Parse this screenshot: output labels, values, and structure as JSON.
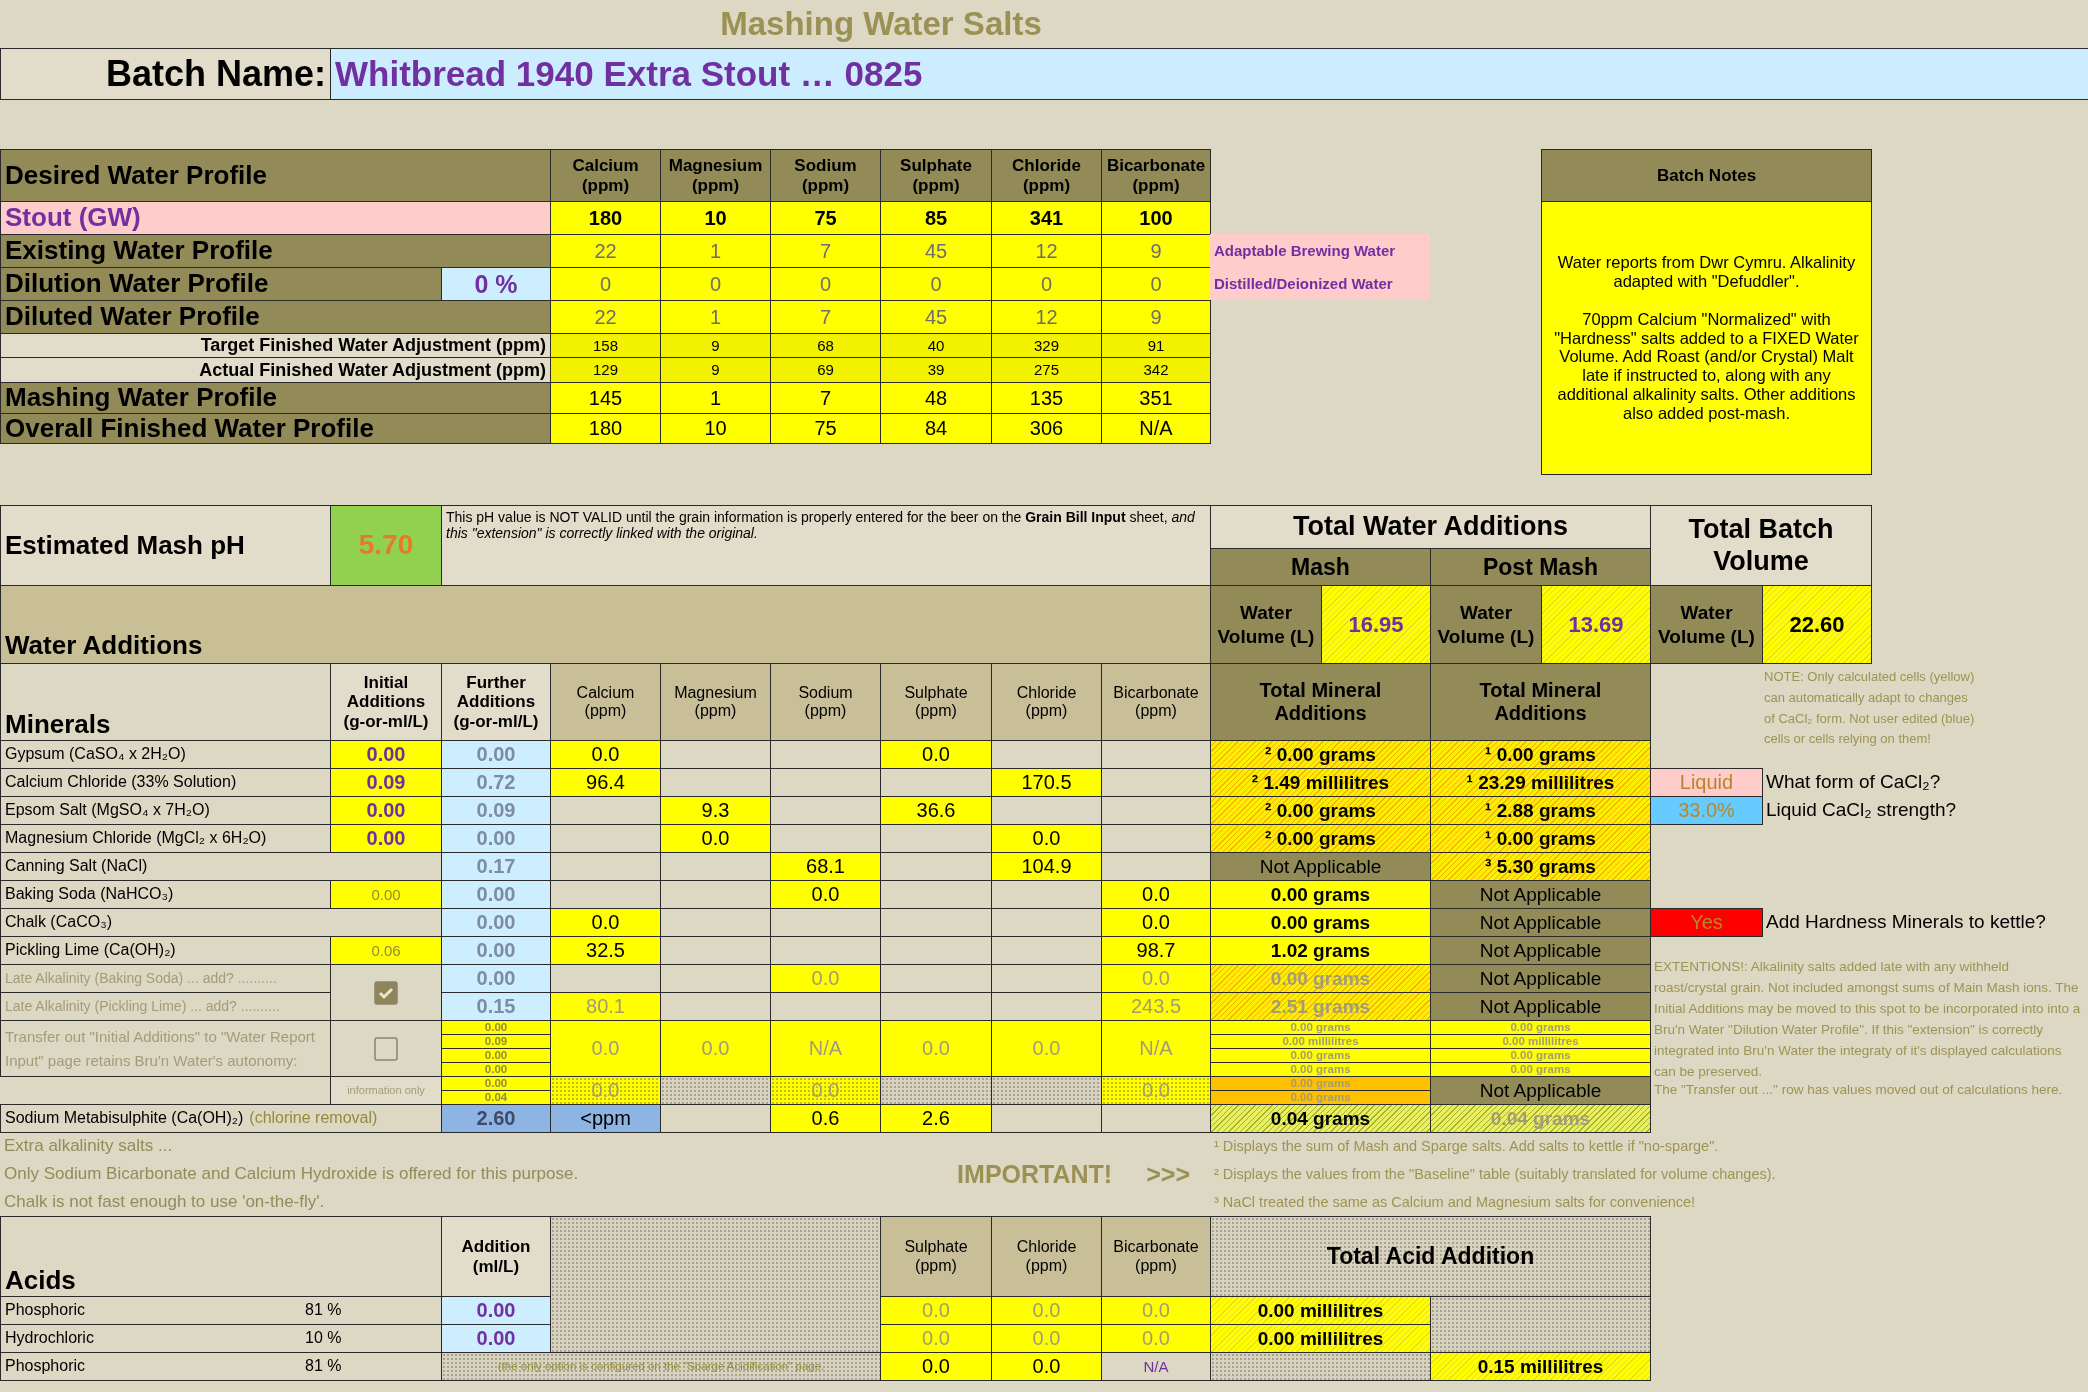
{
  "title": "Mashing Water Salts",
  "batch": {
    "label": "Batch Name:",
    "value": "Whitbread 1940 Extra Stout … 0825"
  },
  "profile": {
    "heading": "Desired Water Profile",
    "columns": [
      {
        "name": "Calcium",
        "unit": "(ppm)"
      },
      {
        "name": "Magnesium",
        "unit": "(ppm)"
      },
      {
        "name": "Sodium",
        "unit": "(ppm)"
      },
      {
        "name": "Sulphate",
        "unit": "(ppm)"
      },
      {
        "name": "Chloride",
        "unit": "(ppm)"
      },
      {
        "name": "Bicarbonate",
        "unit": "(ppm)"
      }
    ],
    "rows": [
      {
        "label": "Stout (GW)",
        "kind": "target",
        "values": [
          "180",
          "10",
          "75",
          "85",
          "341",
          "100"
        ]
      },
      {
        "label": "Existing Water Profile",
        "kind": "source",
        "values": [
          "22",
          "1",
          "7",
          "45",
          "12",
          "9"
        ],
        "source": "Adaptable Brewing Water"
      },
      {
        "label": "Dilution Water Profile",
        "kind": "source",
        "dilution": "0 %",
        "values": [
          "0",
          "0",
          "0",
          "0",
          "0",
          "0"
        ],
        "source": "Distilled/Deionized Water"
      },
      {
        "label": "Diluted Water Profile",
        "kind": "source",
        "values": [
          "22",
          "1",
          "7",
          "45",
          "12",
          "9"
        ]
      },
      {
        "label": "Target Finished Water Adjustment (ppm)",
        "kind": "adjustment",
        "values": [
          "158",
          "9",
          "68",
          "40",
          "329",
          "91"
        ]
      },
      {
        "label": "Actual Finished Water Adjustment (ppm)",
        "kind": "adjustment",
        "values": [
          "129",
          "9",
          "69",
          "39",
          "275",
          "342"
        ]
      },
      {
        "label": "Mashing Water Profile",
        "kind": "result",
        "values": [
          "145",
          "1",
          "7",
          "48",
          "135",
          "351"
        ]
      },
      {
        "label": "Overall Finished Water Profile",
        "kind": "result",
        "values": [
          "180",
          "10",
          "75",
          "84",
          "306",
          "N/A"
        ]
      }
    ]
  },
  "batch_notes": {
    "title": "Batch Notes",
    "paragraphs": [
      "Water reports from Dwr Cymru. Alkalinity adapted with \"Defuddler\".",
      "70ppm Calcium \"Normalized\" with \"Hardness\" salts added to a FIXED Water Volume. Add Roast (and/or Crystal) Malt late if instructed to, along with any additional alkalinity salts. Other additions also added post-mash."
    ]
  },
  "mash_ph": {
    "label": "Estimated Mash pH",
    "value": "5.70",
    "note": "This pH value is NOT VALID until the grain information is properly entered for the beer on the **Grain Bill Input** sheet, *and this \"extension\" is correctly linked with the original.*"
  },
  "water_additions": {
    "heading": "Water Additions",
    "totals_heading": "Total Water Additions",
    "mash": {
      "label": "Mash",
      "volume_label": "Water Volume (L)",
      "volume": "16.95"
    },
    "post_mash": {
      "label": "Post Mash",
      "volume_label": "Water Volume (L)",
      "volume": "13.69"
    },
    "batch_total": {
      "label": "Total Batch Volume",
      "volume_label": "Water Volume (L)",
      "volume": "22.60"
    }
  },
  "minerals": {
    "heading": "Minerals",
    "columns": [
      {
        "name": "Initial Additions",
        "unit": "(g-or-ml/L)",
        "kind": "input"
      },
      {
        "name": "Further Additions",
        "unit": "(g-or-ml/L)",
        "kind": "input"
      },
      {
        "name": "Calcium",
        "unit": "(ppm)",
        "kind": "ion"
      },
      {
        "name": "Magnesium",
        "unit": "(ppm)",
        "kind": "ion"
      },
      {
        "name": "Sodium",
        "unit": "(ppm)",
        "kind": "ion"
      },
      {
        "name": "Sulphate",
        "unit": "(ppm)",
        "kind": "ion"
      },
      {
        "name": "Chloride",
        "unit": "(ppm)",
        "kind": "ion"
      },
      {
        "name": "Bicarbonate",
        "unit": "(ppm)",
        "kind": "ion"
      }
    ],
    "totals_headings": [
      "Total Mineral Additions",
      "Total Mineral Additions"
    ],
    "rows": [
      {
        "kind": "mineral",
        "label": "Gypsum (CaSO₄ x 2H₂O)",
        "initial": {
          "text": "0.00",
          "kind": "entry"
        },
        "further": "0.00",
        "ions": {
          "calcium": "0.0",
          "sulphate": "0.0"
        },
        "mash_total": {
          "text": "² 0.00 grams",
          "kind": "value"
        },
        "post_total": {
          "text": "¹ 0.00 grams",
          "kind": "value"
        }
      },
      {
        "kind": "mineral",
        "label": "Calcium Chloride (33% Solution)",
        "initial": {
          "text": "0.09",
          "kind": "entry"
        },
        "further": "0.72",
        "ions": {
          "calcium": "96.4",
          "chloride": "170.5"
        },
        "mash_total": {
          "text": "² 1.49 millilitres",
          "kind": "value"
        },
        "post_total": {
          "text": "¹ 23.29 millilitres",
          "kind": "value"
        }
      },
      {
        "kind": "mineral",
        "label": "Epsom Salt (MgSO₄ x 7H₂O)",
        "initial": {
          "text": "0.00",
          "kind": "entry"
        },
        "further": "0.09",
        "ions": {
          "magnesium": "9.3",
          "sulphate": "36.6"
        },
        "mash_total": {
          "text": "² 0.00 grams",
          "kind": "value"
        },
        "post_total": {
          "text": "¹ 2.88 grams",
          "kind": "value"
        }
      },
      {
        "kind": "mineral",
        "label": "Magnesium Chloride (MgCl₂ x 6H₂O)",
        "initial": {
          "text": "0.00",
          "kind": "entry"
        },
        "further": "0.00",
        "ions": {
          "magnesium": "0.0",
          "chloride": "0.0"
        },
        "mash_total": {
          "text": "² 0.00 grams",
          "kind": "value"
        },
        "post_total": {
          "text": "¹ 0.00 grams",
          "kind": "value"
        }
      },
      {
        "kind": "mineral",
        "label": "Canning Salt (NaCl)",
        "further": "0.17",
        "ions": {
          "sodium": "68.1",
          "chloride": "104.9"
        },
        "mash_total": {
          "text": "Not Applicable",
          "kind": "na"
        },
        "post_total": {
          "text": "³ 5.30 grams",
          "kind": "value"
        }
      },
      {
        "kind": "mineral",
        "label": "Baking Soda (NaHCO₃)",
        "initial": {
          "text": "0.00",
          "kind": "calc"
        },
        "further": "0.00",
        "ions": {
          "sodium": "0.0",
          "bicarbonate": "0.0"
        },
        "mash_total": {
          "text": "0.00 grams",
          "kind": "plain"
        },
        "post_total": {
          "text": "Not Applicable",
          "kind": "na"
        }
      },
      {
        "kind": "mineral",
        "label": "Chalk (CaCO₃)",
        "further": "0.00",
        "ions": {
          "calcium": "0.0",
          "bicarbonate": "0.0"
        },
        "mash_total": {
          "text": "0.00 grams",
          "kind": "plain"
        },
        "post_total": {
          "text": "Not Applicable",
          "kind": "na"
        }
      },
      {
        "kind": "mineral",
        "label": "Pickling Lime (Ca(OH)₂)",
        "initial": {
          "text": "0.06",
          "kind": "calc"
        },
        "further": "0.00",
        "ions": {
          "calcium": "32.5",
          "bicarbonate": "98.7"
        },
        "mash_total": {
          "text": "1.02 grams",
          "kind": "plain"
        },
        "post_total": {
          "text": "Not Applicable",
          "kind": "na"
        }
      },
      {
        "kind": "late",
        "label": "Late Alkalinity (Baking Soda) ... add? ..........",
        "checkbox": {
          "checked": true
        },
        "further": "0.00",
        "ions": {
          "sodium": "0.0",
          "bicarbonate": "0.0"
        },
        "mash_total": {
          "text": "0.00 grams",
          "kind": "dim"
        },
        "post_total": {
          "text": "Not Applicable",
          "kind": "na"
        }
      },
      {
        "kind": "late",
        "label": "Late Alkalinity (Pickling Lime) ... add? ..........",
        "further": "0.15",
        "ions": {
          "calcium": "80.1",
          "bicarbonate": "243.5"
        },
        "mash_total": {
          "text": "2.51 grams",
          "kind": "dim"
        },
        "post_total": {
          "text": "Not Applicable",
          "kind": "na"
        }
      }
    ],
    "transfer": {
      "label": "Transfer out \"Initial Additions\" to \"Water Report Input\" page retains Bru'n Water's autonomy:",
      "checked": false,
      "info_label": "information only",
      "initial_values": [
        "0.00",
        "0.09",
        "0.00",
        "0.00",
        "0.00",
        "0.04"
      ],
      "ion_values": [
        "0.0",
        "0.0",
        "N/A",
        "0.0",
        "0.0",
        "N/A"
      ],
      "info_ion_values": {
        "calcium": "0.0",
        "sodium": "0.0",
        "bicarbonate": "0.0"
      },
      "mash_totals": [
        "0.00 grams",
        "0.00 millilitres",
        "0.00 grams",
        "0.00 grams",
        "0.00 grams",
        "0.00 grams"
      ],
      "post_totals": [
        "0.00 grams",
        "0.00 millilitres",
        "0.00 grams",
        "0.00 grams"
      ],
      "post_info": "Not Applicable"
    },
    "treatment": {
      "label": "Sodium Metabisulphite (Ca(OH)₂)",
      "note": "(chlorine removal)",
      "further": "2.60",
      "ions": {
        "calcium": "<ppm",
        "sodium": "0.6",
        "sulphate": "2.6"
      },
      "mash_total": {
        "text": "0.04 grams",
        "kind": "sum"
      },
      "post_total": {
        "text": "0.04 grams",
        "kind": "sum-dim"
      }
    }
  },
  "settings": [
    {
      "value": "Liquid",
      "label": "What form of CaCl₂?",
      "color": "#ffcccc"
    },
    {
      "value": "33.0%",
      "label": "Liquid CaCl₂ strength?",
      "color": "#66ccff"
    },
    {
      "value": "Yes",
      "label": "Add Hardness Minerals to kettle?",
      "color": "#ff0000"
    }
  ],
  "side_notes": {
    "calc_note": "NOTE: Only calculated cells (yellow) can automatically adapt to changes of CaCl₂ form. Not user edited (blue) cells or cells relying on them!",
    "extensions": "EXTENTIONS!: Alkalinity salts added late with any withheld roast/crystal grain. Not included amongst sums of Main Mash ions. The Initial Additions may be moved to this spot to be incorporated into into a Bru'n Water \"Dilution Water Profile\". If this \"extension\" is correctly integrated into Bru'n Water the integraty of it's displayed calculations can be preserved.",
    "transfer_note": "The \"Transfer out ...\" row has values moved out of calculations here."
  },
  "alkalinity_notes": [
    "Extra alkalinity salts ...",
    "Only Sodium Bicarbonate and Calcium Hydroxide is offered for this purpose.",
    "Chalk is not fast enough to use 'on-the-fly'."
  ],
  "important": {
    "label": "IMPORTANT!",
    "arrow": ">>>"
  },
  "footnotes": [
    "¹ Displays the sum of Mash and Sparge salts. Add salts to kettle if \"no-sparge\".",
    "² Displays the values from the \"Baseline\" table (suitably translated for volume changes).",
    "³ NaCl treated the same as Calcium and Magnesium salts for convenience!"
  ],
  "acids": {
    "heading": "Acids",
    "addition_header": {
      "name": "Addition",
      "unit": "(ml/L)"
    },
    "columns": [
      {
        "name": "Sulphate",
        "unit": "(ppm)"
      },
      {
        "name": "Chloride",
        "unit": "(ppm)"
      },
      {
        "name": "Bicarbonate",
        "unit": "(ppm)"
      }
    ],
    "total_heading": "Total Acid Addition",
    "rows": [
      {
        "kind": "mash",
        "name": "Phosphoric",
        "strength": "81 %",
        "addition": "0.00",
        "ions": [
          "0.0",
          "0.0",
          "0.0"
        ],
        "total": "0.00 millilitres"
      },
      {
        "kind": "mash",
        "name": "Hydrochloric",
        "strength": "10 %",
        "addition": "0.00",
        "ions": [
          "0.0",
          "0.0",
          "0.0"
        ],
        "total": "0.00 millilitres"
      },
      {
        "kind": "sparge",
        "name": "Phosphoric",
        "strength": "81 %",
        "note": "(the only option is configured on the \"Sparge Acidification\" page.",
        "ions": [
          "0.0",
          "0.0",
          "N/A"
        ],
        "total": "0.15 millilitres"
      }
    ]
  }
}
